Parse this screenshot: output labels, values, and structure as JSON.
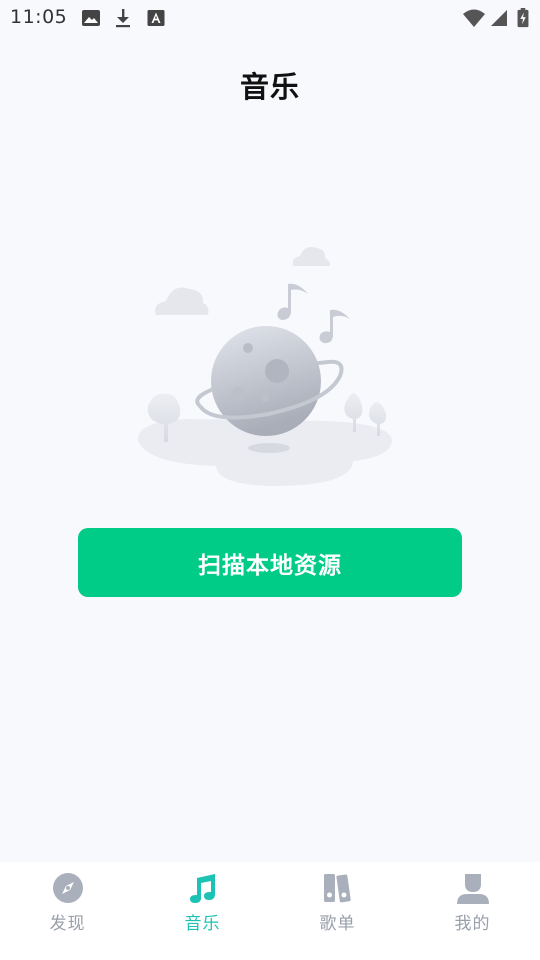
{
  "status_bar": {
    "time": "11:05",
    "icons": [
      "image-icon",
      "download-icon",
      "font-icon",
      "wifi-icon",
      "signal-icon",
      "battery-icon"
    ]
  },
  "header": {
    "title": "音乐"
  },
  "empty_state": {
    "illustration": "planet-with-music-notes"
  },
  "actions": {
    "scan_label": "扫描本地资源"
  },
  "bottom_nav": {
    "active_index": 1,
    "items": [
      {
        "label": "发现",
        "icon": "compass-icon"
      },
      {
        "label": "音乐",
        "icon": "music-note-icon"
      },
      {
        "label": "歌单",
        "icon": "books-icon"
      },
      {
        "label": "我的",
        "icon": "user-icon"
      }
    ]
  },
  "colors": {
    "accent_button": "#00cc88",
    "active_tab": "#1cc3b4",
    "inactive_tab": "#9aa0ab",
    "background": "#f8f9fd"
  }
}
